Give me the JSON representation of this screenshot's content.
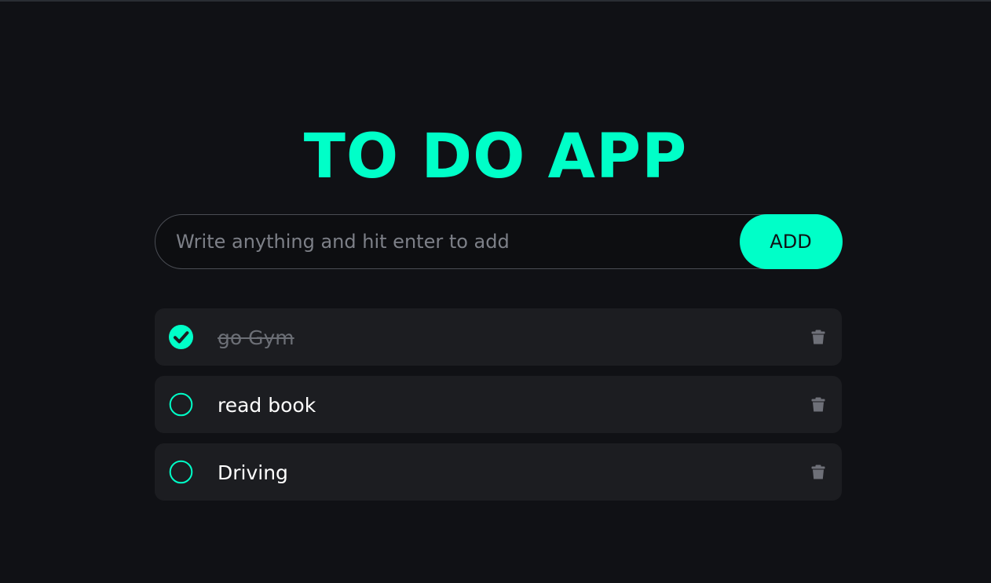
{
  "app": {
    "title": "TO DO APP"
  },
  "add_form": {
    "placeholder": "Write anything and hit enter to add",
    "value": "",
    "button_label": "ADD"
  },
  "todos": [
    {
      "text": "go Gym",
      "completed": true,
      "check_icon": "check-circle-filled-icon",
      "delete_icon": "trash-icon"
    },
    {
      "text": "read book",
      "completed": false,
      "check_icon": "circle-outline-icon",
      "delete_icon": "trash-icon"
    },
    {
      "text": "Driving",
      "completed": false,
      "check_icon": "circle-outline-icon",
      "delete_icon": "trash-icon"
    }
  ],
  "colors": {
    "accent": "#00ffc8",
    "background": "#101115",
    "item_background": "#1c1d21",
    "muted_text": "#6c6f76",
    "icon_gray": "#6e7078"
  }
}
